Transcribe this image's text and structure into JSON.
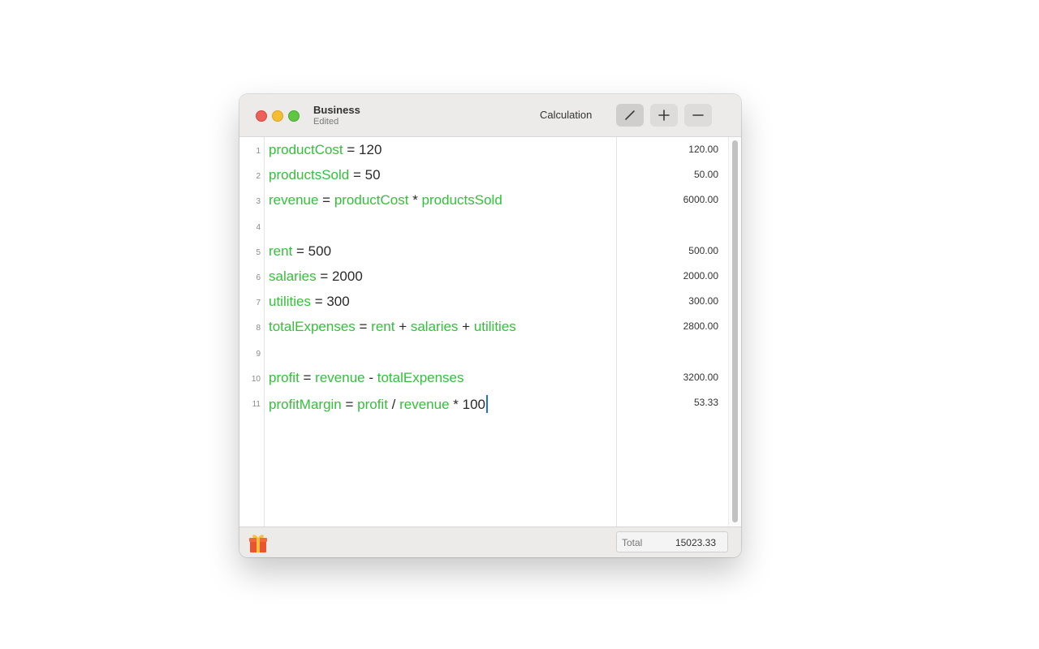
{
  "window": {
    "title": "Business",
    "subtitle": "Edited",
    "mode_label": "Calculation"
  },
  "toolbar": {
    "buttons": [
      {
        "name": "edit",
        "icon": "pencil-icon",
        "active": true
      },
      {
        "name": "add",
        "icon": "plus-icon",
        "active": false
      },
      {
        "name": "remove",
        "icon": "minus-icon",
        "active": false
      }
    ]
  },
  "editor": {
    "lines": [
      {
        "number": "1",
        "tokens": [
          {
            "t": "productCost",
            "k": "v"
          },
          {
            "t": " = 120",
            "k": "o"
          }
        ]
      },
      {
        "number": "2",
        "tokens": [
          {
            "t": "productsSold",
            "k": "v"
          },
          {
            "t": " = 50",
            "k": "o"
          }
        ]
      },
      {
        "number": "3",
        "tokens": [
          {
            "t": "revenue",
            "k": "v"
          },
          {
            "t": " = ",
            "k": "o"
          },
          {
            "t": "productCost",
            "k": "v"
          },
          {
            "t": " * ",
            "k": "o"
          },
          {
            "t": "productsSold",
            "k": "v"
          }
        ]
      },
      {
        "number": "4",
        "tokens": []
      },
      {
        "number": "5",
        "tokens": [
          {
            "t": "rent",
            "k": "v"
          },
          {
            "t": " = 500",
            "k": "o"
          }
        ]
      },
      {
        "number": "6",
        "tokens": [
          {
            "t": "salaries",
            "k": "v"
          },
          {
            "t": " = 2000",
            "k": "o"
          }
        ]
      },
      {
        "number": "7",
        "tokens": [
          {
            "t": "utilities",
            "k": "v"
          },
          {
            "t": " = 300",
            "k": "o"
          }
        ]
      },
      {
        "number": "8",
        "tokens": [
          {
            "t": "totalExpenses",
            "k": "v"
          },
          {
            "t": " = ",
            "k": "o"
          },
          {
            "t": "rent",
            "k": "v"
          },
          {
            "t": " + ",
            "k": "o"
          },
          {
            "t": "salaries",
            "k": "v"
          },
          {
            "t": " + ",
            "k": "o"
          },
          {
            "t": "utilities",
            "k": "v"
          }
        ]
      },
      {
        "number": "9",
        "tokens": []
      },
      {
        "number": "10",
        "tokens": [
          {
            "t": "profit",
            "k": "v"
          },
          {
            "t": " = ",
            "k": "o"
          },
          {
            "t": "revenue",
            "k": "v"
          },
          {
            "t": " - ",
            "k": "o"
          },
          {
            "t": "totalExpenses",
            "k": "v"
          }
        ]
      },
      {
        "number": "11",
        "tokens": [
          {
            "t": "profitMargin",
            "k": "v"
          },
          {
            "t": " = ",
            "k": "o"
          },
          {
            "t": "profit",
            "k": "v"
          },
          {
            "t": " / ",
            "k": "o"
          },
          {
            "t": "revenue",
            "k": "v"
          },
          {
            "t": " * 100",
            "k": "o"
          }
        ],
        "caret": true
      }
    ],
    "results": [
      "120.00",
      "50.00",
      "6000.00",
      "",
      "500.00",
      "2000.00",
      "300.00",
      "2800.00",
      "",
      "3200.00",
      "53.33"
    ]
  },
  "footer": {
    "gift_icon": "gift-icon",
    "total_label": "Total",
    "total_value": "15023.33"
  },
  "colors": {
    "variable": "#33c13a",
    "operator": "#2a2a2a",
    "caret": "#1a6dff",
    "close": "#ee5f57",
    "minimize": "#f5bd30",
    "maximize": "#5fc640"
  }
}
